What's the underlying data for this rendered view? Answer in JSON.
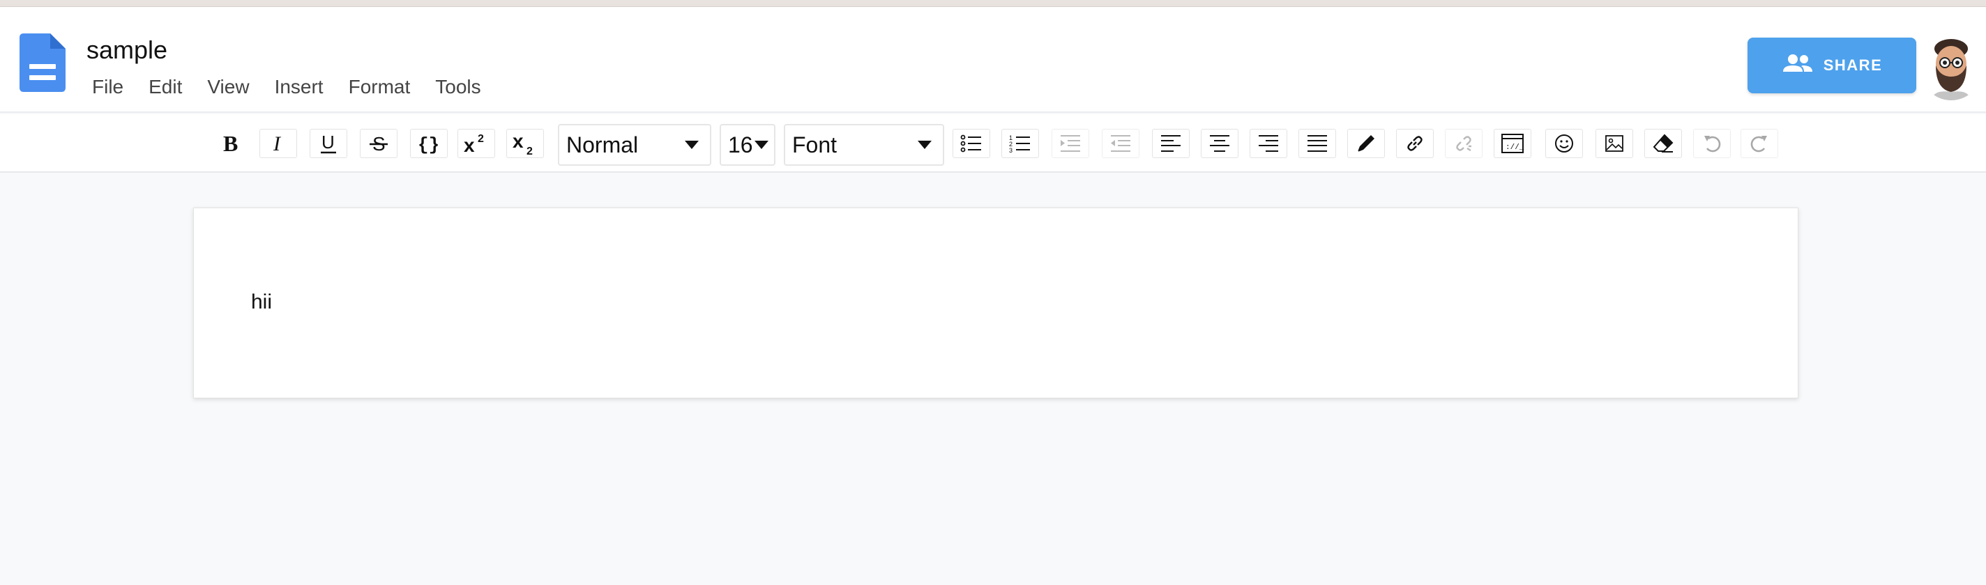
{
  "document": {
    "title": "sample",
    "content": "hii"
  },
  "menu": [
    "File",
    "Edit",
    "View",
    "Insert",
    "Format",
    "Tools"
  ],
  "share": {
    "label": "SHARE"
  },
  "toolbar": {
    "paragraph_style": "Normal",
    "font_size": "16",
    "font_family": "Font"
  },
  "icons": {
    "doc": "file-document-icon",
    "share": "people-icon",
    "avatar": "user-avatar"
  },
  "colors": {
    "brand_blue": "#4ea1ec",
    "doc_icon": "#4a8ef0",
    "canvas_bg": "#f8f9fa"
  }
}
